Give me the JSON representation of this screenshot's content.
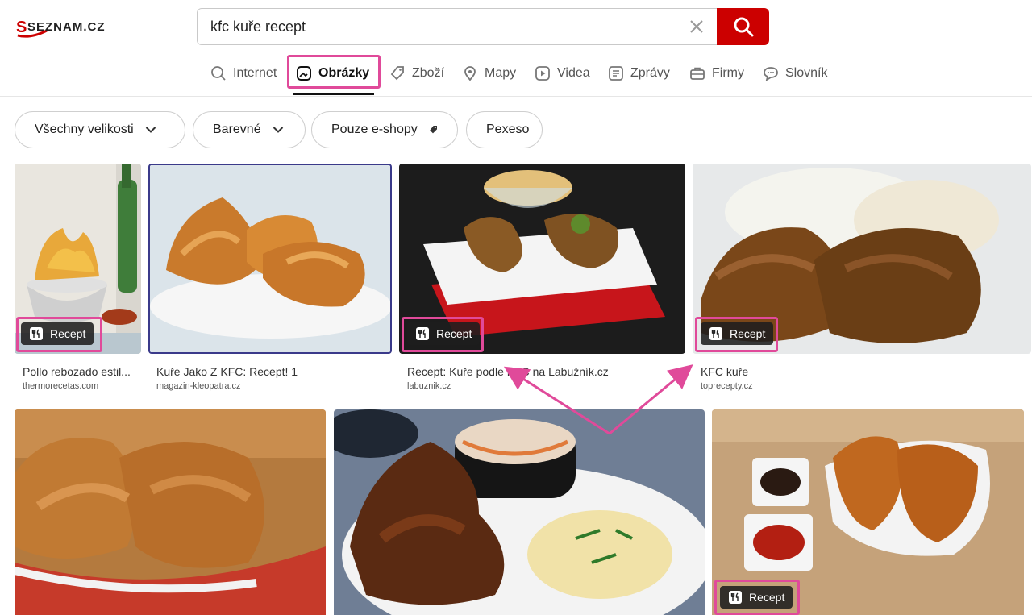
{
  "header": {
    "logo_text": "SEZNAM.CZ",
    "search": {
      "value": "kfc kuře recept",
      "placeholder": ""
    }
  },
  "tabs": [
    {
      "label": "Internet",
      "icon": "search-icon"
    },
    {
      "label": "Obrázky",
      "icon": "image-icon",
      "active": true
    },
    {
      "label": "Zboží",
      "icon": "tag-icon"
    },
    {
      "label": "Mapy",
      "icon": "map-pin-icon"
    },
    {
      "label": "Videa",
      "icon": "play-icon"
    },
    {
      "label": "Zprávy",
      "icon": "news-icon"
    },
    {
      "label": "Firmy",
      "icon": "briefcase-icon"
    },
    {
      "label": "Slovník",
      "icon": "chat-icon"
    }
  ],
  "filters": [
    {
      "label": "Všechny velikosti",
      "icon": "chevron-down-icon"
    },
    {
      "label": "Barevné",
      "icon": "chevron-down-icon"
    },
    {
      "label": "Pouze e-shopy",
      "icon": "tag-icon"
    },
    {
      "label": "Pexeso"
    }
  ],
  "badge_label": "Recept",
  "results": [
    {
      "title": "Pollo rebozado estil...",
      "source": "thermorecetas.com",
      "recipe": true
    },
    {
      "title": "Kuře Jako Z KFC: Recept! 1",
      "source": "magazin-kleopatra.cz",
      "recipe": false
    },
    {
      "title": "Recept: Kuře podle KFC na Labužník.cz",
      "source": "labuznik.cz",
      "recipe": true
    },
    {
      "title": "KFC kuře",
      "source": "toprecepty.cz",
      "recipe": true
    },
    {
      "title": "",
      "source": "",
      "recipe": false
    },
    {
      "title": "",
      "source": "",
      "recipe": false
    },
    {
      "title": "",
      "source": "",
      "recipe": true
    }
  ],
  "colors": {
    "brand_red": "#cc0000",
    "highlight": "#e04a9a"
  }
}
